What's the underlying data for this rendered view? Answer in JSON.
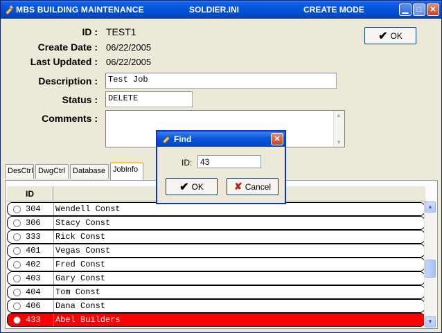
{
  "window": {
    "title_left": "MBS BUILDING MAINTENANCE",
    "title_mid": "SOLDIER.INI",
    "title_right": "CREATE MODE"
  },
  "form": {
    "id_label": "ID :",
    "id_value": "TEST1",
    "create_label": "Create Date :",
    "create_value": "06/22/2005",
    "updated_label": "Last Updated :",
    "updated_value": "06/22/2005",
    "desc_label": "Description :",
    "desc_value": "Test Job",
    "status_label": "Status :",
    "status_value": "DELETE",
    "comments_label": "Comments :",
    "comments_value": ""
  },
  "ok_button": "OK",
  "tabs": [
    "DesCtrl",
    "DwgCtrl",
    "Database",
    "JobInfo"
  ],
  "active_tab": "JobInfo",
  "grid": {
    "header_id": "ID",
    "rows": [
      {
        "id": "304",
        "name": "Wendell Const"
      },
      {
        "id": "306",
        "name": "Stacy Const"
      },
      {
        "id": "333",
        "name": "Rick Const"
      },
      {
        "id": "401",
        "name": "Vegas Const"
      },
      {
        "id": "402",
        "name": "Fred Const"
      },
      {
        "id": "403",
        "name": "Gary Const"
      },
      {
        "id": "404",
        "name": "Tom Const"
      },
      {
        "id": "406",
        "name": "Dana Const"
      },
      {
        "id": "433",
        "name": "Abel Builders"
      }
    ],
    "selected_id": "433",
    "selected_color": "#ff0000"
  },
  "find_dialog": {
    "title": "Find",
    "id_label": "ID:",
    "id_value": "43",
    "ok_label": "OK",
    "cancel_label": "Cancel"
  },
  "colors": {
    "titlebar": "#0553d8",
    "window_bg": "#ece9d8"
  }
}
